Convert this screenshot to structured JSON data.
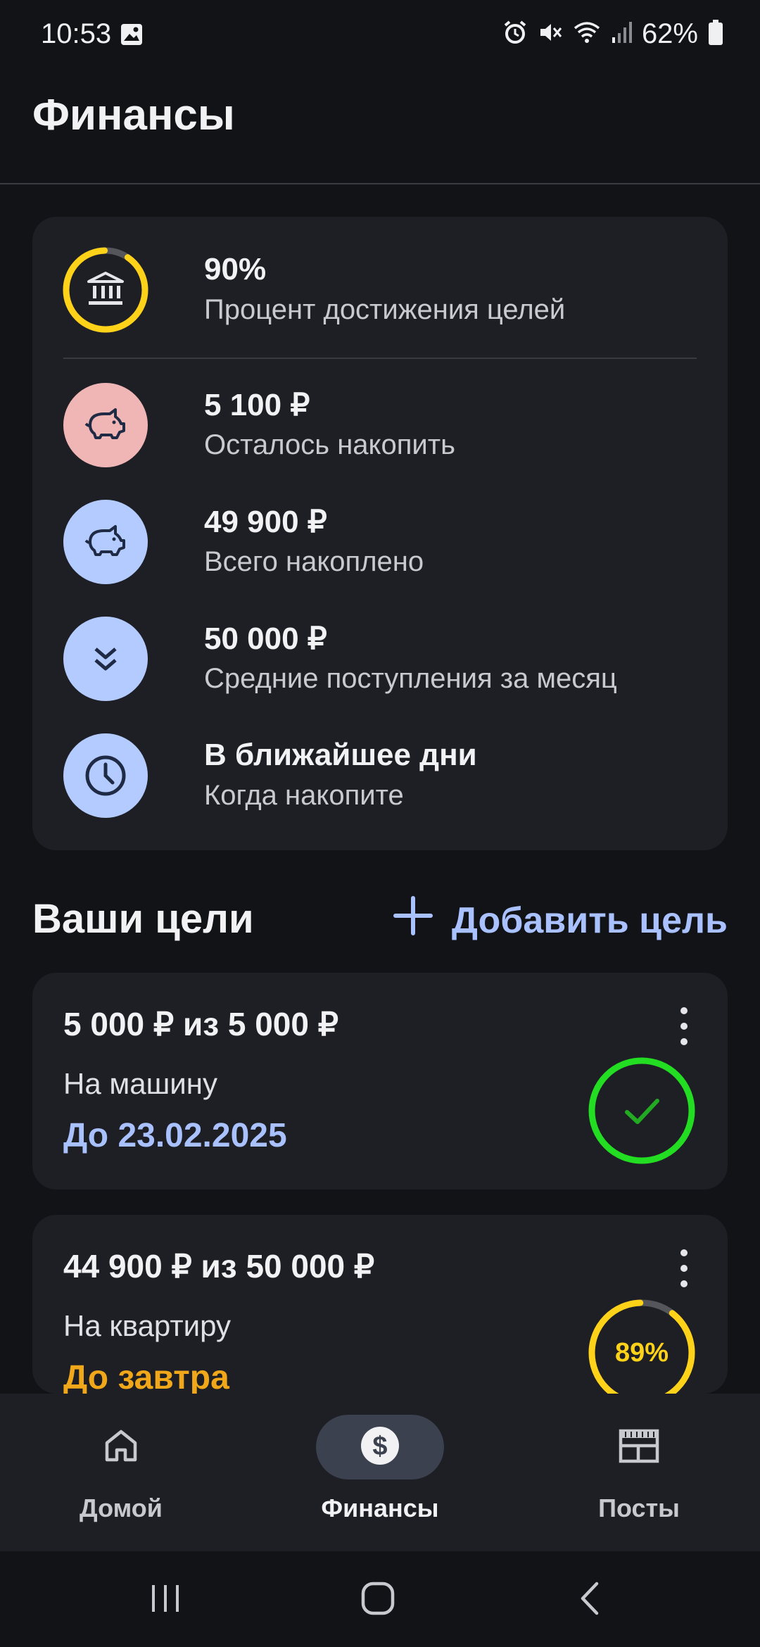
{
  "status": {
    "time": "10:53",
    "battery": "62%"
  },
  "header": {
    "title": "Финансы"
  },
  "summary": {
    "goal_percent": {
      "value": "90%",
      "label": "Процент достижения целей",
      "progress": 0.9
    },
    "remaining": {
      "value": "5 100 ₽",
      "label": "Осталось накопить"
    },
    "total_saved": {
      "value": "49 900 ₽",
      "label": "Всего накоплено"
    },
    "avg_income": {
      "value": "50 000 ₽",
      "label": "Средние поступления за месяц"
    },
    "eta": {
      "value": "В ближайшее дни",
      "label": "Когда накопите"
    }
  },
  "goals_section": {
    "title": "Ваши цели",
    "add_label": "Добавить цель"
  },
  "goals": [
    {
      "amount": "5 000 ₽ из 5 000 ₽",
      "name": "На машину",
      "deadline": "До 23.02.2025",
      "deadline_color": "#a9c1ff",
      "status": "complete",
      "ring_color": "#22dd22"
    },
    {
      "amount": "44 900 ₽ из 50 000 ₽",
      "name": "На квартиру",
      "deadline": "До завтра",
      "deadline_color": "#f0a81a",
      "percent_label": "89%",
      "progress": 0.89,
      "ring_color": "#ffd21a"
    }
  ],
  "nav": {
    "home": "Домой",
    "finance": "Финансы",
    "posts": "Посты"
  },
  "colors": {
    "accent_blue": "#a9c1ff",
    "pink": "#f0b5b5",
    "light_blue": "#b3cbff",
    "yellow": "#ffd21a",
    "green": "#22dd22"
  }
}
